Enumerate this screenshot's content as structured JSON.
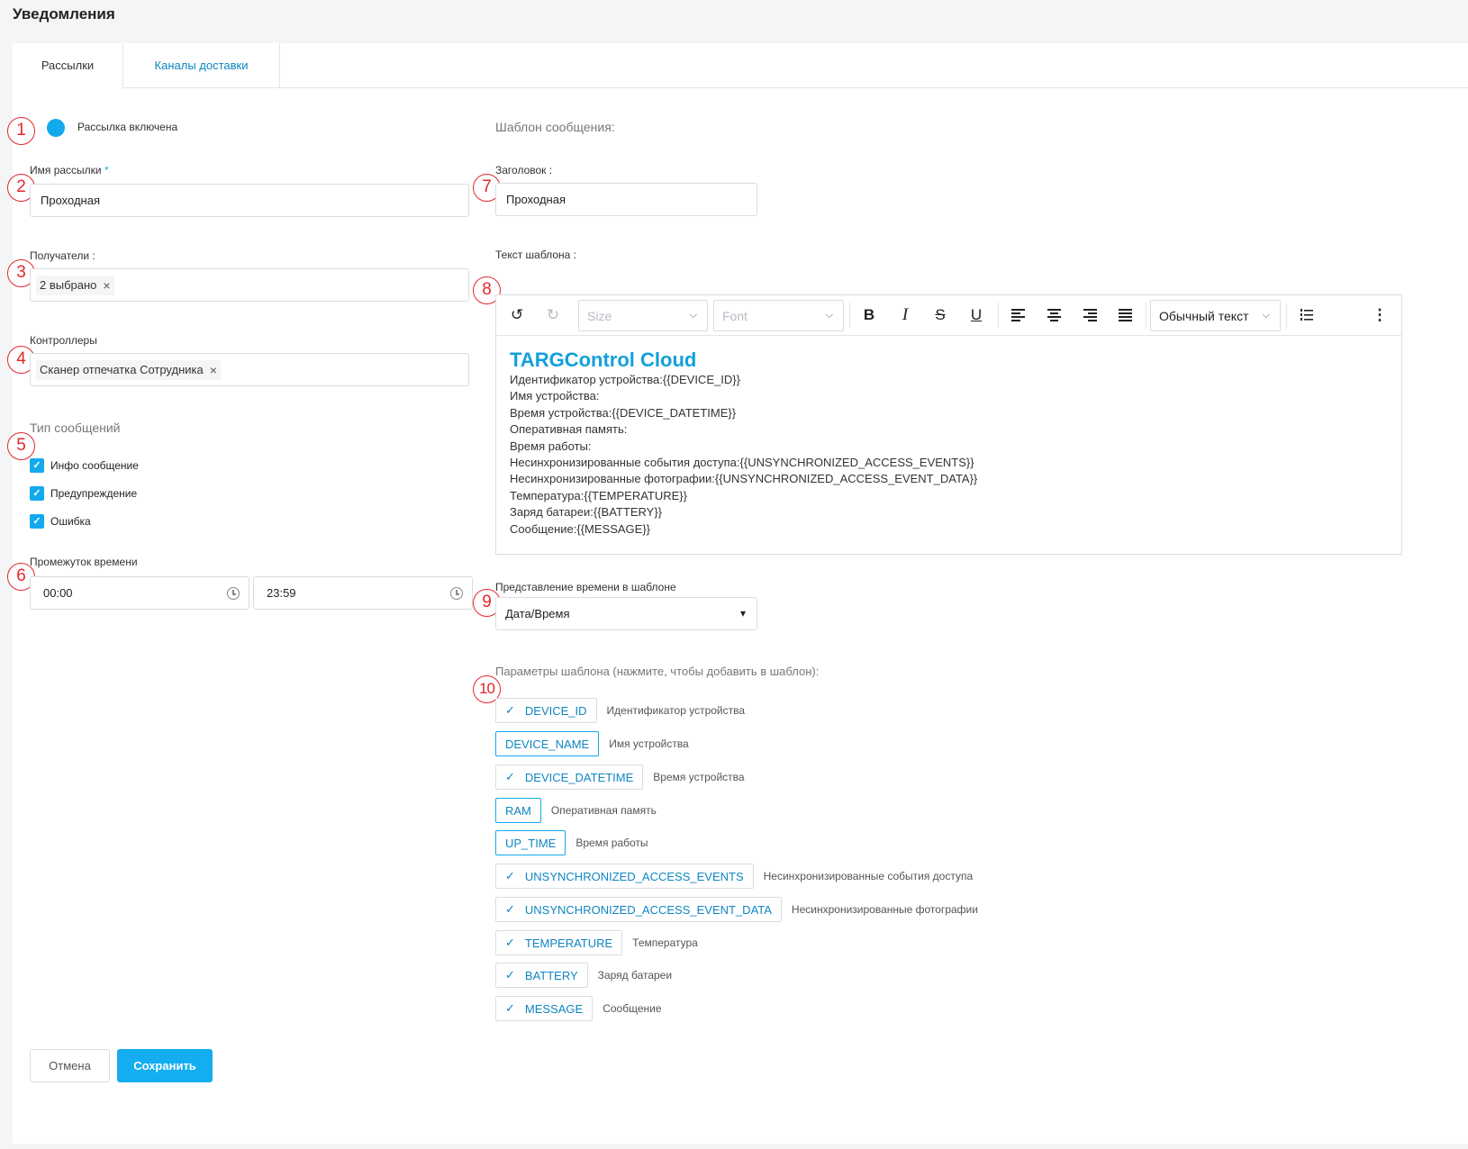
{
  "page": {
    "title": "Уведомления"
  },
  "tabs": [
    {
      "label": "Рассылки"
    },
    {
      "label": "Каналы доставки"
    }
  ],
  "markers": [
    "1",
    "2",
    "3",
    "4",
    "5",
    "6",
    "7",
    "8",
    "9",
    "10"
  ],
  "form": {
    "enabled_label": "Рассылка включена",
    "name_label": "Имя рассылки",
    "name_required": "*",
    "name_value": "Проходная",
    "recipients_label": "Получатели :",
    "recipients_chip": "2 выбрано",
    "controllers_label": "Контроллеры",
    "controllers_chip": "Сканер отпечатка Сотрудника",
    "chip_remove": "×",
    "types_title": "Тип сообщений",
    "types": [
      "Инфо сообщение",
      "Предупреждение",
      "Ошибка"
    ],
    "checkmark": "✓",
    "time_label": "Промежуток времени",
    "time_from": "00:00",
    "time_to": "23:59"
  },
  "template": {
    "title": "Шаблон сообщения:",
    "header_label": "Заголовок :",
    "header_value": "Проходная",
    "text_label": "Текст шаблона :",
    "toolbar": {
      "undo": "↺",
      "redo": "↻",
      "size": "Size",
      "font": "Font",
      "dropdown_arrow": "⌵",
      "bold": "B",
      "italic": "I",
      "strike": "S",
      "underline": "U",
      "style": "Обычный текст",
      "more": "⋮"
    },
    "content_heading": "TARGControl Cloud",
    "content_lines": [
      {
        "label": "Идентификатор устройства:",
        "token": "{{DEVICE_ID}}"
      },
      {
        "label": "Имя устройства:",
        "token": ""
      },
      {
        "label": "Время устройства:",
        "token": "{{DEVICE_DATETIME}}"
      },
      {
        "label": "Оперативная память:",
        "token": ""
      },
      {
        "label": "Время работы:",
        "token": ""
      },
      {
        "label": "Несинхронизированные события доступа:",
        "token": "{{UNSYNCHRONIZED_ACCESS_EVENTS}}"
      },
      {
        "label": "Несинхронизированные фотографии:",
        "token": "{{UNSYNCHRONIZED_ACCESS_EVENT_DATA}}"
      },
      {
        "label": "Температура:",
        "token": "{{TEMPERATURE}}"
      },
      {
        "label": "Заряд батареи:",
        "token": "{{BATTERY}}"
      },
      {
        "label": "Сообщение:",
        "token": "{{MESSAGE}}"
      }
    ],
    "time_repr_label": "Представление времени в шаблоне",
    "time_repr_value": "Дата/Время",
    "select_arrow": "▾",
    "params_title": "Параметры шаблона (нажмите, чтобы добавить в шаблон):",
    "params": [
      {
        "key": "DEVICE_ID",
        "desc": "Идентификатор устройства",
        "checked": true
      },
      {
        "key": "DEVICE_NAME",
        "desc": "Имя устройства",
        "checked": false
      },
      {
        "key": "DEVICE_DATETIME",
        "desc": "Время устройства",
        "checked": true
      },
      {
        "key": "RAM",
        "desc": "Оперативная память",
        "checked": false
      },
      {
        "key": "UP_TIME",
        "desc": "Время работы",
        "checked": false
      },
      {
        "key": "UNSYNCHRONIZED_ACCESS_EVENTS",
        "desc": "Несинхронизированные события доступа",
        "checked": true
      },
      {
        "key": "UNSYNCHRONIZED_ACCESS_EVENT_DATA",
        "desc": "Несинхронизированные фотографии",
        "checked": true
      },
      {
        "key": "TEMPERATURE",
        "desc": "Температура",
        "checked": true
      },
      {
        "key": "BATTERY",
        "desc": "Заряд батареи",
        "checked": true
      },
      {
        "key": "MESSAGE",
        "desc": "Сообщение",
        "checked": true
      }
    ]
  },
  "actions": {
    "cancel": "Отмена",
    "save": "Сохранить"
  },
  "colors": {
    "accent": "#14a9ec",
    "marker": "#e3262b",
    "link": "#0e86c1"
  }
}
